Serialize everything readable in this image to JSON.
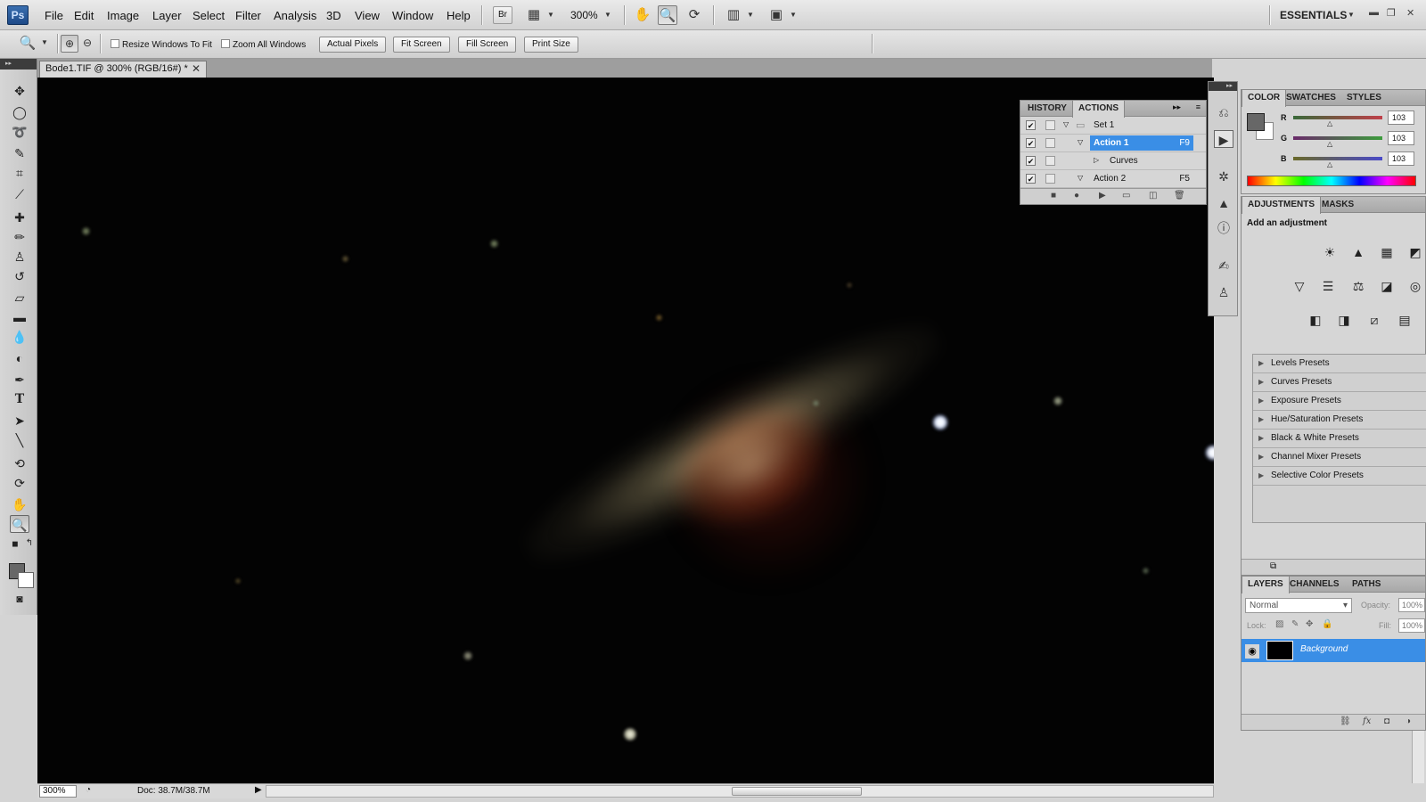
{
  "menubar": {
    "logo": "Ps",
    "items": [
      "File",
      "Edit",
      "Image",
      "Layer",
      "Select",
      "Filter",
      "Analysis",
      "3D",
      "View",
      "Window",
      "Help"
    ],
    "bridge_label": "Br",
    "zoom_level": "300%",
    "workspace": "ESSENTIALS"
  },
  "options": {
    "resize_windows": "Resize Windows To Fit",
    "zoom_all": "Zoom All Windows",
    "actual_pixels": "Actual Pixels",
    "fit_screen": "Fit Screen",
    "fill_screen": "Fill Screen",
    "print_size": "Print Size"
  },
  "document": {
    "tab_title": "Bode1.TIF @ 300% (RGB/16#) *",
    "zoom": "300%",
    "doc_info": "Doc: 38.7M/38.7M"
  },
  "actions_panel": {
    "tabs": [
      "HISTORY",
      "ACTIONS"
    ],
    "rows": [
      {
        "label": "Set 1",
        "key": ""
      },
      {
        "label": "Action 1",
        "key": "F9"
      },
      {
        "label": "Curves",
        "key": ""
      },
      {
        "label": "Action 2",
        "key": "F5"
      }
    ]
  },
  "color_panel": {
    "tabs": [
      "COLOR",
      "SWATCHES",
      "STYLES"
    ],
    "channels": [
      {
        "label": "R",
        "value": "103",
        "color": "#c0404a"
      },
      {
        "label": "G",
        "value": "103",
        "color": "#3c9c3c"
      },
      {
        "label": "B",
        "value": "103",
        "color": "#4a4ac8"
      }
    ],
    "foreground": "#676767"
  },
  "adjustments_panel": {
    "tabs": [
      "ADJUSTMENTS",
      "MASKS"
    ],
    "title": "Add an adjustment",
    "presets": [
      "Levels Presets",
      "Curves Presets",
      "Exposure Presets",
      "Hue/Saturation Presets",
      "Black & White Presets",
      "Channel Mixer Presets",
      "Selective Color Presets"
    ]
  },
  "layers_panel": {
    "tabs": [
      "LAYERS",
      "CHANNELS",
      "PATHS"
    ],
    "blend_mode": "Normal",
    "opacity_label": "Opacity:",
    "opacity": "100%",
    "lock_label": "Lock:",
    "fill_label": "Fill:",
    "fill": "100%",
    "layer_name": "Background"
  }
}
